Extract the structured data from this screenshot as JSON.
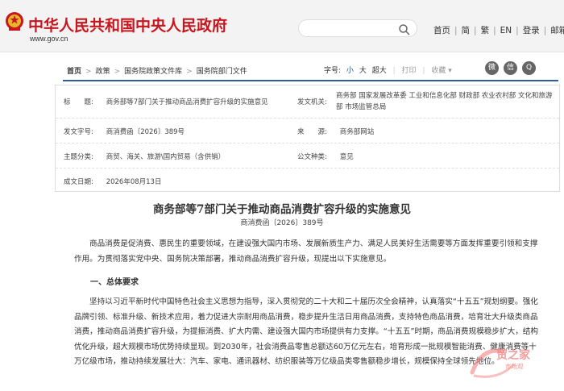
{
  "header": {
    "site_title": "中华人民共和国中央人民政府",
    "site_url": "www.gov.cn",
    "nav": [
      "首页",
      "简",
      "繁",
      "EN",
      "登录",
      "邮箱"
    ]
  },
  "breadcrumb": {
    "items": [
      "首页",
      "政策",
      "国务院政策文件库",
      "国务院部门文件"
    ]
  },
  "toolbar": {
    "font_label": "字号:",
    "size_small": "小",
    "size_large": "大",
    "size_xlarge": "超大",
    "print": "打印",
    "collect": "收藏",
    "share_label": "留言"
  },
  "info": {
    "title_label": "标　　题:",
    "title_value": "商务部等7部门关于推动商品消费扩容升级的实施意见",
    "issuer_label": "发文机关:",
    "issuer_value": "商务部 国家发展改革委 工业和信息化部 财政部 农业农村部 文化和旅游部 市场监管总局",
    "doc_no_label": "发文字号:",
    "doc_no_value": "商消费函〔2026〕389号",
    "source_label": "来　　源:",
    "source_value": "商务部网站",
    "category_label": "主题分类:",
    "category_value": "商贸、海关、旅游\\国内贸易（含供销）",
    "type_label": "公文种类:",
    "type_value": "意见",
    "date_label": "成文日期:",
    "date_value": "2026年08月13日"
  },
  "document": {
    "title": "商务部等7部门关于推动商品消费扩容升级的实施意见",
    "number": "商消费函〔2026〕389号",
    "para1": "商品消费是促消费、惠民生的重要领域，在建设强大国内市场、发展新质生产力、满足人民美好生活需要等方面发挥重要引领和支撑作用。为贯彻落实党中央、国务院决策部署，推动商品消费扩容升级，现提出以下实施意见。",
    "section1": "一、总体要求",
    "para2": "坚持以习近平新时代中国特色社会主义思想为指导，深入贯彻党的二十大和二十届历次全会精神，认真落实“十五五”规划纲要。强化品牌引领、标准升级、新技术应用，着力促进大宗耐用商品消费，稳步提升生活日用商品消费，支持特色商品消费，培育壮大升级类商品消费，推动商品消费扩容升级，为提振消费、扩大内需、建设强大国内市场提供有力支撑。“十五五”时期，商品消费规模稳步扩大，结构优化升级，超大规模市场优势持续显现。到2030年，社会消费品零售总额达60万亿元左右，培育形成一批规模智能消费、健康消费等十万亿级市场，推动持续发展壮大：汽车、家电、通讯器材、纺织服装等万亿级品类零售额稳步增长，规模保持全球领先地位。"
  },
  "watermark": {
    "text": "贸之家",
    "sub": "市场观"
  },
  "colors": {
    "brand_red": "#c8161e",
    "accent_blue": "#2b5e9c"
  }
}
